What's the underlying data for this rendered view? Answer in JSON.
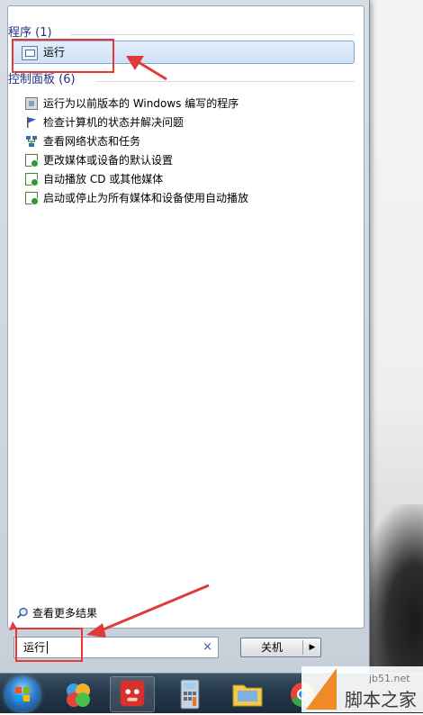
{
  "programs": {
    "header": "程序 (1)",
    "items": [
      {
        "label": "运行",
        "icon": "run-dialog-icon"
      }
    ]
  },
  "control_panel": {
    "header": "控制面板 (6)",
    "items": [
      {
        "label": "运行为以前版本的 Windows 编写的程序",
        "icon": "compatibility-icon"
      },
      {
        "label": "检查计算机的状态并解决问题",
        "icon": "action-center-flag-icon"
      },
      {
        "label": "查看网络状态和任务",
        "icon": "network-icon"
      },
      {
        "label": "更改媒体或设备的默认设置",
        "icon": "autoplay-icon"
      },
      {
        "label": "自动播放 CD 或其他媒体",
        "icon": "autoplay-icon"
      },
      {
        "label": "启动或停止为所有媒体和设备使用自动播放",
        "icon": "autoplay-icon"
      }
    ]
  },
  "see_more": {
    "label": "查看更多结果"
  },
  "search": {
    "value": "运行",
    "clear_symbol": "×"
  },
  "shutdown": {
    "label": "关机",
    "arrow": "▶"
  },
  "watermark": {
    "url": "jb51.net",
    "text": "脚本之家"
  },
  "colors": {
    "annotation": "#e23a3a",
    "group_header": "#1e3287",
    "highlight": "#cfe2f8"
  }
}
